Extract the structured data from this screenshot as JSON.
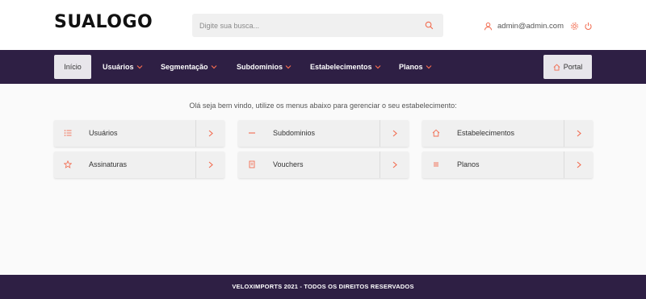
{
  "header": {
    "logo": "SUALOGO",
    "search_placeholder": "Digite sua busca...",
    "user_email": "admin@admin.com"
  },
  "nav": {
    "home": "Início",
    "items": [
      {
        "label": "Usuários"
      },
      {
        "label": "Segmentação"
      },
      {
        "label": "Subdominios"
      },
      {
        "label": "Estabelecimentos"
      },
      {
        "label": "Planos"
      }
    ],
    "portal": "Portal"
  },
  "main": {
    "welcome": "Olá seja bem vindo, utilize os menus abaixo para gerenciar o seu estabelecimento:",
    "cards": [
      {
        "label": "Usuários",
        "icon": "list-icon"
      },
      {
        "label": "Subdominios",
        "icon": "dash-icon"
      },
      {
        "label": "Estabelecimentos",
        "icon": "home-icon"
      },
      {
        "label": "Assinaturas",
        "icon": "star-icon"
      },
      {
        "label": "Vouchers",
        "icon": "document-icon"
      },
      {
        "label": "Planos",
        "icon": "lines-icon"
      }
    ]
  },
  "footer": {
    "text": "VELOXIMPORTS 2021 - TODOS OS DIREITOS RESERVADOS"
  },
  "colors": {
    "accent": "#f26b4f",
    "nav_bg": "#2e1f44"
  }
}
